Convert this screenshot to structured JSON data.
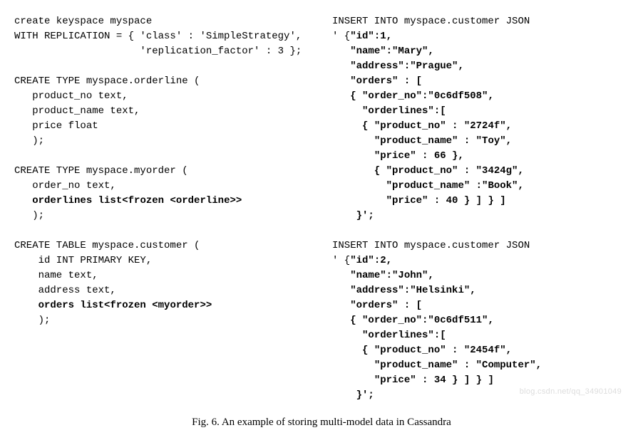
{
  "left": {
    "l1": "create keyspace myspace",
    "l2": "WITH REPLICATION = { 'class' : 'SimpleStrategy',",
    "l3": "                     'replication_factor' : 3 };",
    "l4": "",
    "l5": "CREATE TYPE myspace.orderline (",
    "l6": "   product_no text,",
    "l7": "   product_name text,",
    "l8": "   price float",
    "l9": "   );",
    "l10": "",
    "l11": "CREATE TYPE myspace.myorder (",
    "l12": "   order_no text,",
    "l13a": "   ",
    "l13b": "orderlines list<frozen <orderline>>",
    "l14": "   );",
    "l15": "",
    "l16": "CREATE TABLE myspace.customer (",
    "l17": "    id INT PRIMARY KEY,",
    "l18": "    name text,",
    "l19": "    address text,",
    "l20a": "    ",
    "l20b": "orders list<frozen <myorder>>",
    "l21": "    );"
  },
  "right": {
    "r1": "INSERT INTO myspace.customer JSON",
    "r2a": "' {",
    "r2b": "\"id\":1,",
    "r3a": "   ",
    "r3b": "\"name\":\"Mary\",",
    "r4a": "   ",
    "r4b": "\"address\":\"Prague\",",
    "r5a": "   ",
    "r5b": "\"orders\" : [",
    "r6a": "   ",
    "r6b": "{ \"order_no\":\"0c6df508\",",
    "r7a": "     ",
    "r7b": "\"orderlines\":[",
    "r8a": "     ",
    "r8b": "{ \"product_no\" : \"2724f\",",
    "r9a": "       ",
    "r9b": "\"product_name\" : \"Toy\",",
    "r10a": "       ",
    "r10b": "\"price\" : 66 },",
    "r11a": "       ",
    "r11b": "{ \"product_no\" : \"3424g\",",
    "r12a": "         ",
    "r12b": "\"product_name\" :\"Book\",",
    "r13a": "         ",
    "r13b": "\"price\" : 40 } ] } ]",
    "r14a": "    ",
    "r14b": "}';",
    "r15": "",
    "r16": "INSERT INTO myspace.customer JSON",
    "r17a": "' {",
    "r17b": "\"id\":2,",
    "r18a": "   ",
    "r18b": "\"name\":\"John\",",
    "r19a": "   ",
    "r19b": "\"address\":\"Helsinki\",",
    "r20a": "   ",
    "r20b": "\"orders\" : [",
    "r21a": "   ",
    "r21b": "{ \"order_no\":\"0c6df511\",",
    "r22a": "     ",
    "r22b": "\"orderlines\":[",
    "r23a": "     ",
    "r23b": "{ \"product_no\" : \"2454f\",",
    "r24a": "       ",
    "r24b": "\"product_name\" : \"Computer\",",
    "r25a": "       ",
    "r25b": "\"price\" : 34 } ] } ]",
    "r26a": "    ",
    "r26b": "}';"
  },
  "caption": "Fig. 6.   An example of storing multi-model data in Cassandra",
  "watermark": "blog.csdn.net/qq_34901049"
}
